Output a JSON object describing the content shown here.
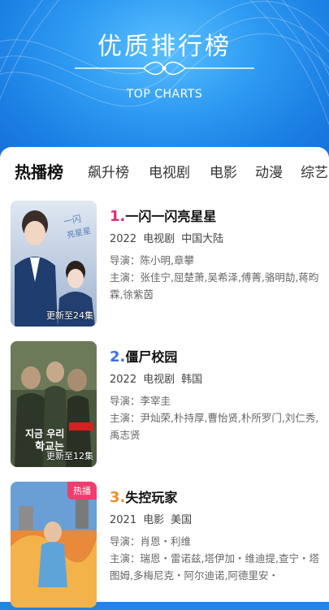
{
  "banner": {
    "title": "优质排行榜",
    "subtitle": "TOP CHARTS"
  },
  "tabs": [
    "热播榜",
    "飙升榜",
    "电视剧",
    "电影",
    "动漫",
    "综艺"
  ],
  "items": [
    {
      "rank": "1.",
      "title": "一闪一闪亮星星",
      "year": "2022",
      "type": "电视剧",
      "region": "中国大陆",
      "director_label": "导演：",
      "director": "陈小明,章攀",
      "cast_label": "主演：",
      "cast": "张佳宁,屈楚萧,吴希泽,傅菁,骆明劼,蒋昀霖,徐紫茵",
      "poster_text": "一闪一闪亮星星",
      "badge": "更新至24集"
    },
    {
      "rank": "2.",
      "title": "僵尸校园",
      "year": "2022",
      "type": "电视剧",
      "region": "韩国",
      "director_label": "导演：",
      "director": "李宰圭",
      "cast_label": "主演：",
      "cast": "尹灿荣,朴持厚,曹怡贤,朴所罗门,刘仁秀,禹志贤",
      "poster_text": "지금 우리 학교는",
      "badge": "更新至12集"
    },
    {
      "rank": "3.",
      "title": "失控玩家",
      "year": "2021",
      "type": "电影",
      "region": "美国",
      "director_label": "导演：",
      "director": "肖恩・利维",
      "cast_label": "主演：",
      "cast": "瑞恩・雷诺兹,塔伊加・维迪提,查宁・塔图姆,多梅尼克・阿尔迪诺,阿德里安・",
      "hot": "热播"
    }
  ],
  "colors": {
    "accent_pink": "#e6287d",
    "banner_blue": "#1e86e6"
  }
}
